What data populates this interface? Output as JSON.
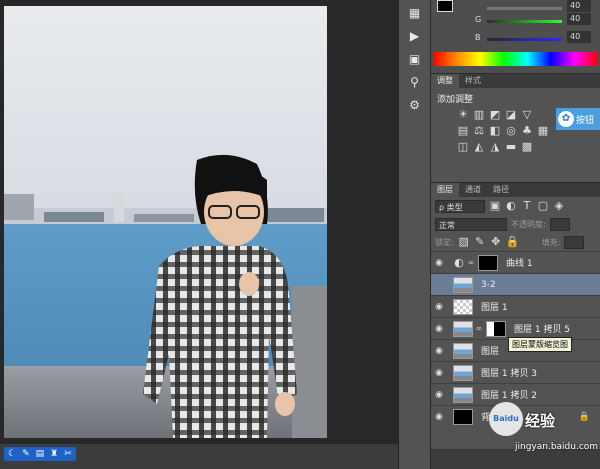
{
  "color": {
    "g_label": "G",
    "g_value": "40",
    "b_label": "B",
    "b_value": "40",
    "top_value": "40"
  },
  "adjust_tabs": [
    "调整",
    "样式"
  ],
  "adjust_title": "添加调整",
  "baidu_tip": "按钮",
  "layer_tabs": [
    "图层",
    "通道",
    "路径"
  ],
  "filter": {
    "kind": "ρ 类型"
  },
  "blend": {
    "mode": "正常",
    "opacity_label": "不透明度:"
  },
  "lock": {
    "label": "锁定:",
    "fill_label": "填充:"
  },
  "layers": [
    {
      "name": "曲线 1"
    },
    {
      "name": "3-2"
    },
    {
      "name": "图层 1"
    },
    {
      "name": "图层 1 拷贝 5"
    },
    {
      "name": "图层"
    },
    {
      "name": "图层 1 拷贝 3"
    },
    {
      "name": "图层 1 拷贝 2"
    },
    {
      "name": "背"
    }
  ],
  "tooltip": "图层蒙版缩览图",
  "watermark": {
    "logo": "Baidu",
    "text": "经验",
    "url": "jingyan.baidu.com"
  }
}
